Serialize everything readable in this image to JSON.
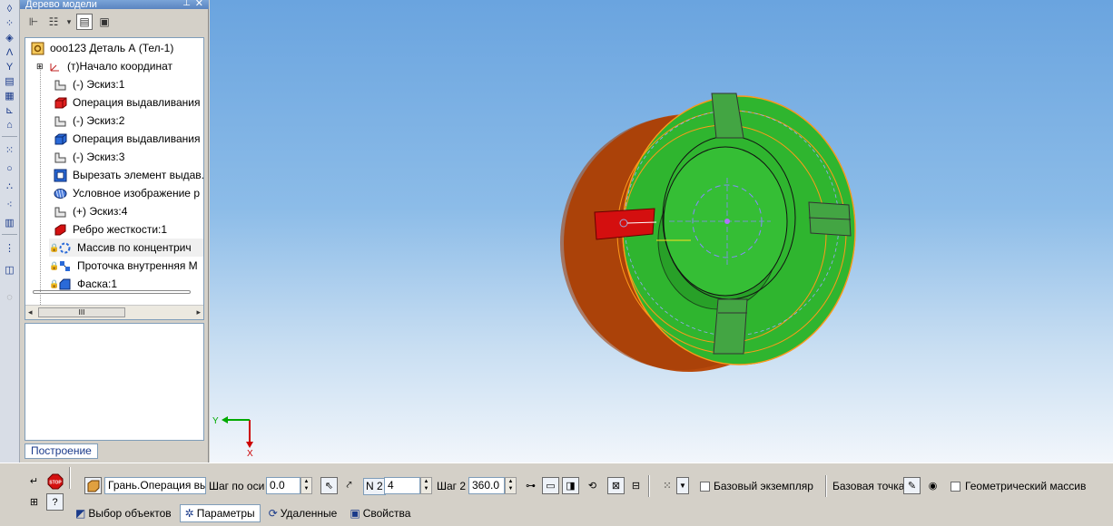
{
  "tree": {
    "title": "Дерево модели",
    "items": [
      {
        "label": "ооо123 Деталь А (Тел-1)",
        "icon": "part-icon"
      },
      {
        "label": "(т)Начало координат",
        "icon": "origin-icon"
      },
      {
        "label": "(-) Эскиз:1",
        "icon": "sketch-icon"
      },
      {
        "label": "Операция выдавливания",
        "icon": "extrude-icon"
      },
      {
        "label": "(-) Эскиз:2",
        "icon": "sketch-icon"
      },
      {
        "label": "Операция выдавливания",
        "icon": "extrude-icon"
      },
      {
        "label": "(-) Эскиз:3",
        "icon": "sketch-icon"
      },
      {
        "label": "Вырезать элемент выдав.",
        "icon": "cut-extrude-icon"
      },
      {
        "label": "Условное изображение р",
        "icon": "thread-icon"
      },
      {
        "label": "(+) Эскиз:4",
        "icon": "sketch-icon"
      },
      {
        "label": "Ребро жесткости:1",
        "icon": "rib-icon"
      },
      {
        "label": "Массив по концентрич",
        "icon": "circular-array-icon"
      },
      {
        "label": "Проточка внутренняя М",
        "icon": "groove-icon"
      },
      {
        "label": "Фаска:1",
        "icon": "chamfer-icon"
      }
    ],
    "scroll_thumb": "III",
    "tab_label": "Построение"
  },
  "viewport": {
    "axis_y": "Y",
    "axis_x": "X"
  },
  "props": {
    "face_field": "Грань.Операция вы",
    "step_axis_label": "Шаг по оси",
    "step_axis_value": "0.0",
    "n2_label": "N 2",
    "n2_value": "4",
    "step2_label": "Шаг 2",
    "step2_value": "360.0",
    "base_instance_label": "Базовый экземпляр",
    "base_point_label": "Базовая точка",
    "geometric_array_label": "Геометрический массив",
    "stop_label": "STOP"
  },
  "tabs": [
    {
      "label": "Выбор объектов",
      "icon": "select-icon"
    },
    {
      "label": "Параметры",
      "icon": "parameters-icon",
      "active": true
    },
    {
      "label": "Удаленные",
      "icon": "deleted-icon"
    },
    {
      "label": "Свойства",
      "icon": "properties-icon"
    }
  ],
  "colors": {
    "face_green": "#2fb52f",
    "body_brown": "#b84a0c",
    "rib_red": "#d40f0f",
    "selection_orange": "#ff9a1a",
    "viewport_top": "#6aa4df"
  }
}
